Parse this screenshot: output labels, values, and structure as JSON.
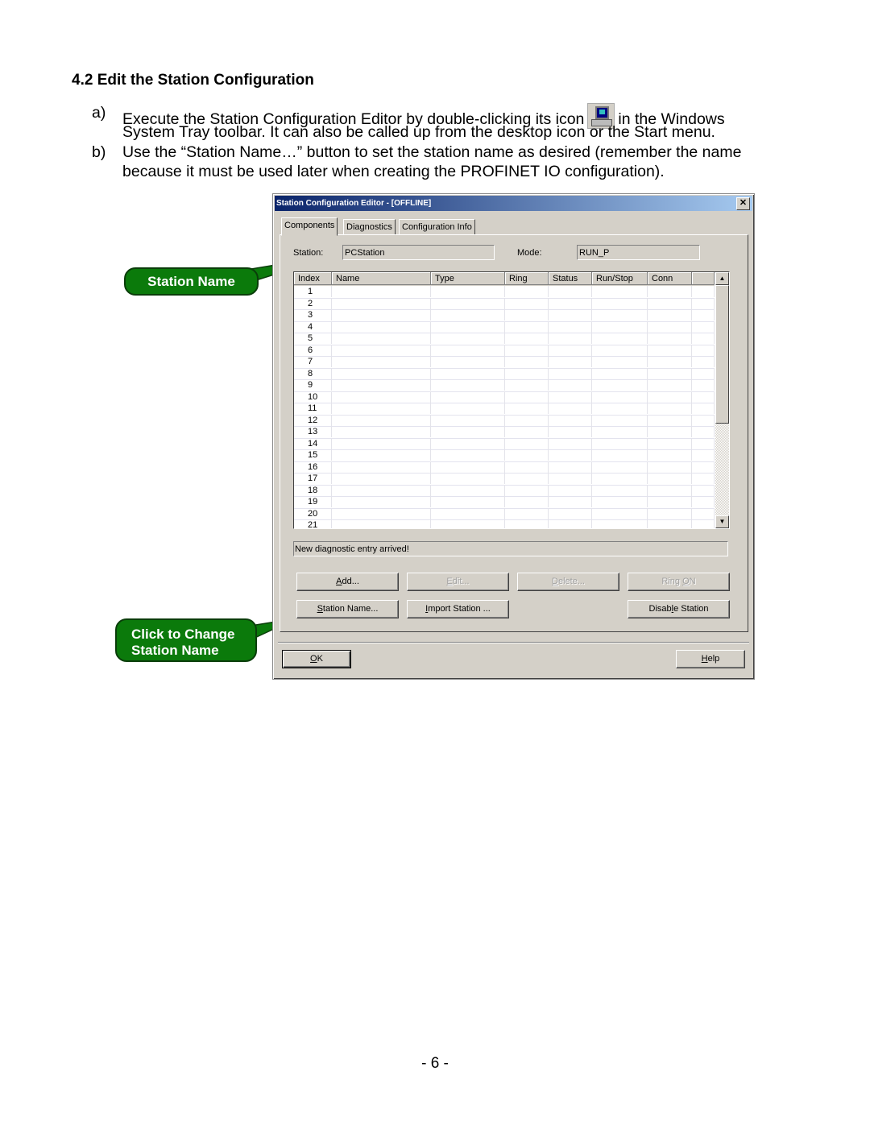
{
  "document": {
    "heading": "4.2  Edit the Station Configuration",
    "items": [
      {
        "label": "a)",
        "line1_before_icon": "Execute the Station Configuration Editor by double-clicking its icon",
        "icon": "station-config-tray-icon",
        "line1_after_icon": "in the Windows",
        "line2": "System Tray toolbar.  It can also be called up from the desktop icon or the Start menu."
      },
      {
        "label": "b)",
        "line1": "Use the “Station Name…” button to set the station name as desired (remember the name",
        "line2": "because it must be used later when creating the PROFINET IO configuration)."
      }
    ],
    "page_number": "- 6 -"
  },
  "callouts": {
    "station_name": "Station Name",
    "click_to_change_line1": "Click to Change",
    "click_to_change_line2": "Station Name"
  },
  "window": {
    "title": "Station Configuration Editor - [OFFLINE]",
    "close_glyph": "✕",
    "tabs": [
      {
        "label": "Components",
        "active": true
      },
      {
        "label": "Diagnostics",
        "active": false
      },
      {
        "label": "Configuration Info",
        "active": false
      }
    ],
    "station_label": "Station:",
    "station_value": "PCStation",
    "mode_label": "Mode:",
    "mode_value": "RUN_P",
    "table": {
      "columns": [
        "Index",
        "Name",
        "Type",
        "Ring",
        "Status",
        "Run/Stop",
        "Conn",
        ""
      ],
      "rows": [
        "1",
        "2",
        "3",
        "4",
        "5",
        "6",
        "7",
        "8",
        "9",
        "10",
        "11",
        "12",
        "13",
        "14",
        "15",
        "16",
        "17",
        "18",
        "19",
        "20",
        "21"
      ]
    },
    "scroll_up_glyph": "▲",
    "scroll_down_glyph": "▼",
    "status_text": "New diagnostic entry arrived!",
    "buttons": {
      "add": {
        "pre": "",
        "u": "A",
        "post": "dd...",
        "enabled": true
      },
      "edit": {
        "pre": "",
        "u": "E",
        "post": "dit...",
        "enabled": false
      },
      "delete": {
        "pre": "",
        "u": "D",
        "post": "elete...",
        "enabled": false
      },
      "ring_on": {
        "pre": "Ring ",
        "u": "O",
        "post": "N",
        "enabled": false
      },
      "station_name": {
        "pre": "",
        "u": "S",
        "post": "tation Name...",
        "enabled": true
      },
      "import_station": {
        "pre": "",
        "u": "I",
        "post": "mport Station ...",
        "enabled": true
      },
      "disable_station": {
        "pre": "Disab",
        "u": "l",
        "post": "e Station",
        "enabled": true
      },
      "ok": {
        "pre": "",
        "u": "O",
        "post": "K",
        "enabled": true
      },
      "help": {
        "pre": "",
        "u": "H",
        "post": "elp",
        "enabled": true
      }
    }
  }
}
